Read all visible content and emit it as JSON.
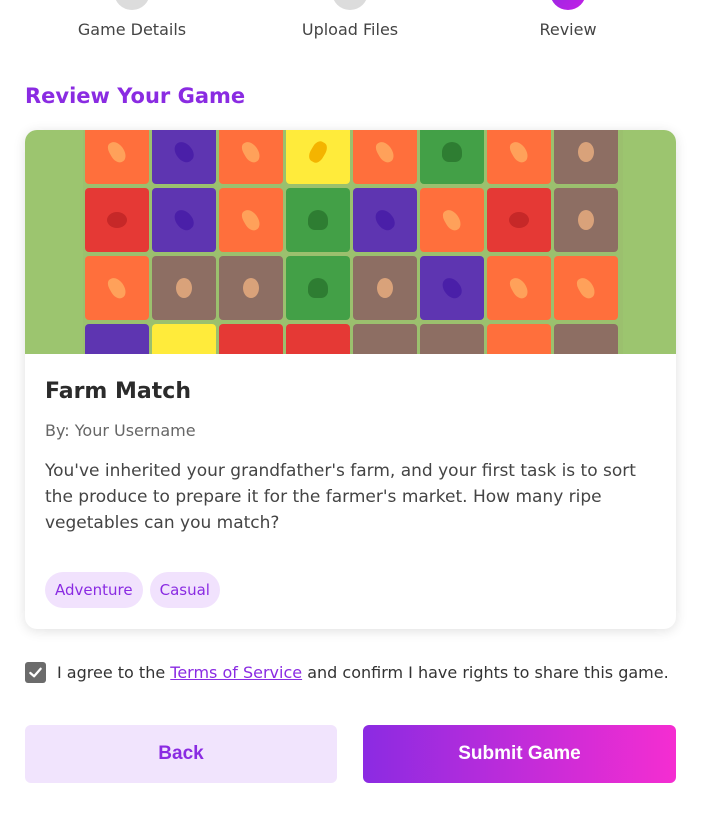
{
  "stepper": {
    "steps": [
      {
        "label": "Game Details",
        "state": "complete"
      },
      {
        "label": "Upload Files",
        "state": "complete"
      },
      {
        "label": "Review",
        "state": "active"
      }
    ]
  },
  "review": {
    "title": "Review Your Game"
  },
  "game": {
    "title": "Farm Match",
    "author": "By: Your Username",
    "description": "You've inherited your grandfather's farm, and your first task is to sort the produce to prepare it for the farmer's market. How many ripe vegetables can you match?",
    "tags": [
      "Adventure",
      "Casual"
    ]
  },
  "agreement": {
    "checked": true,
    "prefix": "I agree to the",
    "link": "Terms of Service",
    "suffix": "and confirm I have rights to share this game."
  },
  "buttons": {
    "back": "Back",
    "submit": "Submit Game"
  },
  "colors": {
    "accent": "#8a2be2",
    "gradient_end": "#f52dd1",
    "tag_bg": "#f1e2fd",
    "banner_bg": "#9cc56f"
  },
  "banner_tiles": [
    [
      "green",
      "red",
      "brown",
      "red",
      "orange",
      "green",
      "brown",
      "green"
    ],
    [
      "orange:carrot",
      "purple:eggplant",
      "orange:carrot",
      "yellow:corn",
      "orange:carrot",
      "green:broccoli",
      "orange:carrot",
      "brown:potato"
    ],
    [
      "red:tomato",
      "purple:eggplant",
      "orange:carrot",
      "green:broccoli",
      "purple:eggplant",
      "orange:carrot",
      "red:tomato",
      "brown:potato"
    ],
    [
      "orange:carrot",
      "brown:potato",
      "brown:potato",
      "green:broccoli",
      "brown:potato",
      "purple:eggplant",
      "orange:carrot",
      "orange:carrot"
    ],
    [
      "purple",
      "yellow",
      "red",
      "red",
      "brown",
      "brown",
      "orange",
      "brown"
    ]
  ]
}
